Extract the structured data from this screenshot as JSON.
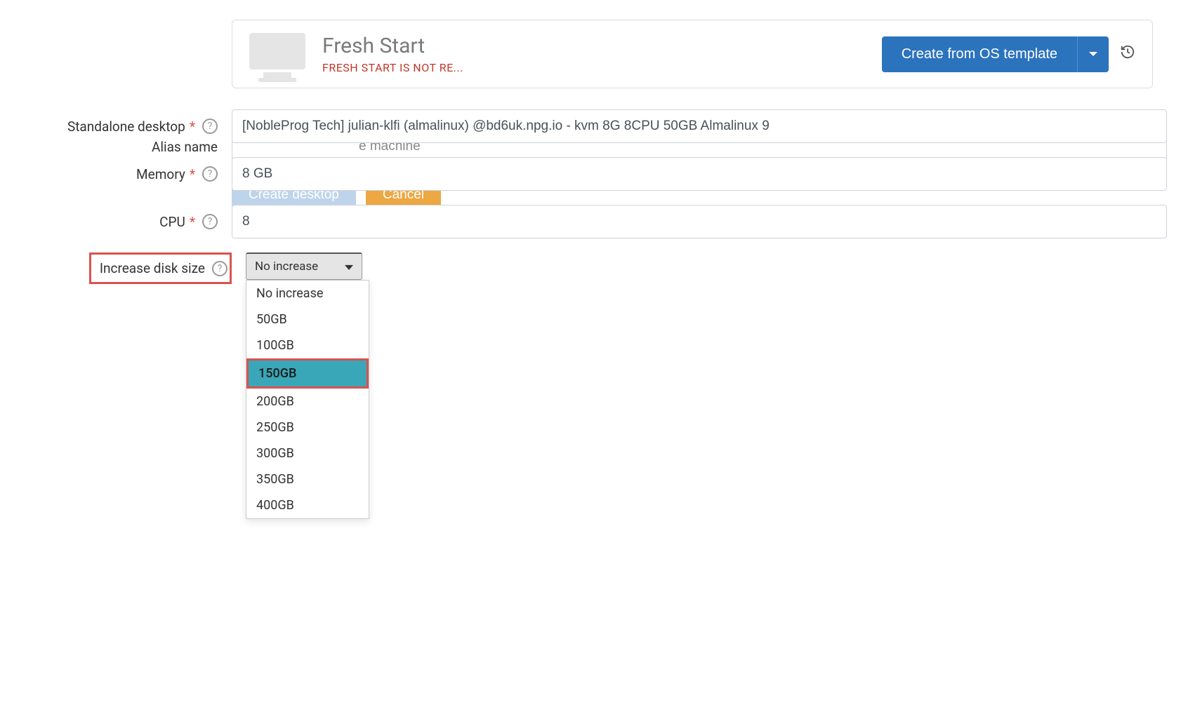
{
  "header": {
    "title": "Fresh Start",
    "subtitle": "FRESH START IS NOT RE...",
    "createButton": "Create from OS template"
  },
  "form": {
    "standaloneDesktop": {
      "label": "Standalone desktop",
      "value": "[NobleProg Tech] julian-klfi (almalinux) @bd6uk.npg.io - kvm 8G 8CPU 50GB Almalinux 9"
    },
    "memory": {
      "label": "Memory",
      "value": "8 GB"
    },
    "cpu": {
      "label": "CPU",
      "value": "8"
    },
    "increaseDiskSize": {
      "label": "Increase disk size",
      "selected": "No increase",
      "options": [
        "No increase",
        "50GB",
        "100GB",
        "150GB",
        "200GB",
        "250GB",
        "300GB",
        "350GB",
        "400GB"
      ],
      "highlightedOption": "150GB"
    },
    "aliasName": {
      "label": "Alias name",
      "placeholder": "e machine"
    },
    "buttons": {
      "create": "Create desktop",
      "cancel": "Cancel"
    }
  }
}
